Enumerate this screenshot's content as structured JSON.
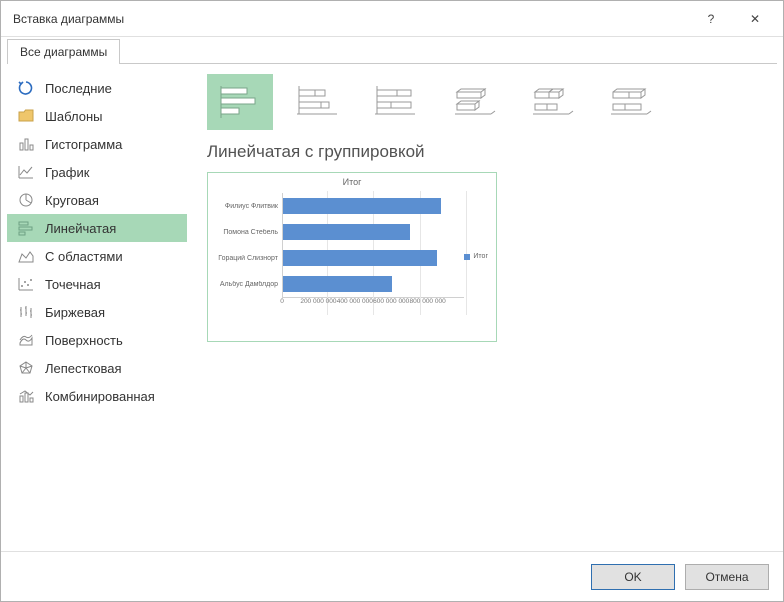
{
  "dialog": {
    "title": "Вставка диаграммы",
    "help_symbol": "?",
    "close_symbol": "✕"
  },
  "tab": {
    "label": "Все диаграммы"
  },
  "sidebar": {
    "items": [
      {
        "label": "Последние"
      },
      {
        "label": "Шаблоны"
      },
      {
        "label": "Гистограмма"
      },
      {
        "label": "График"
      },
      {
        "label": "Круговая"
      },
      {
        "label": "Линейчатая"
      },
      {
        "label": "С областями"
      },
      {
        "label": "Точечная"
      },
      {
        "label": "Биржевая"
      },
      {
        "label": "Поверхность"
      },
      {
        "label": "Лепестковая"
      },
      {
        "label": "Комбинированная"
      }
    ]
  },
  "chart_heading": "Линейчатая с группировкой",
  "chart_data": {
    "type": "bar",
    "title": "Итог",
    "orientation": "horizontal",
    "categories": [
      "Филиус Флитвик",
      "Помона Стебель",
      "Гораций Слизнорт",
      "Альбус Дамблдор"
    ],
    "values": [
      700000000,
      560000000,
      680000000,
      480000000
    ],
    "xlabel": "",
    "ylabel": "",
    "xlim": [
      0,
      800000000
    ],
    "ticks": [
      "0",
      "200 000 000",
      "400 000 000",
      "600 000 000",
      "800 000 000"
    ],
    "series_name": "Итог",
    "legend_position": "right",
    "grid": true
  },
  "buttons": {
    "ok": "OK",
    "cancel": "Отмена"
  }
}
